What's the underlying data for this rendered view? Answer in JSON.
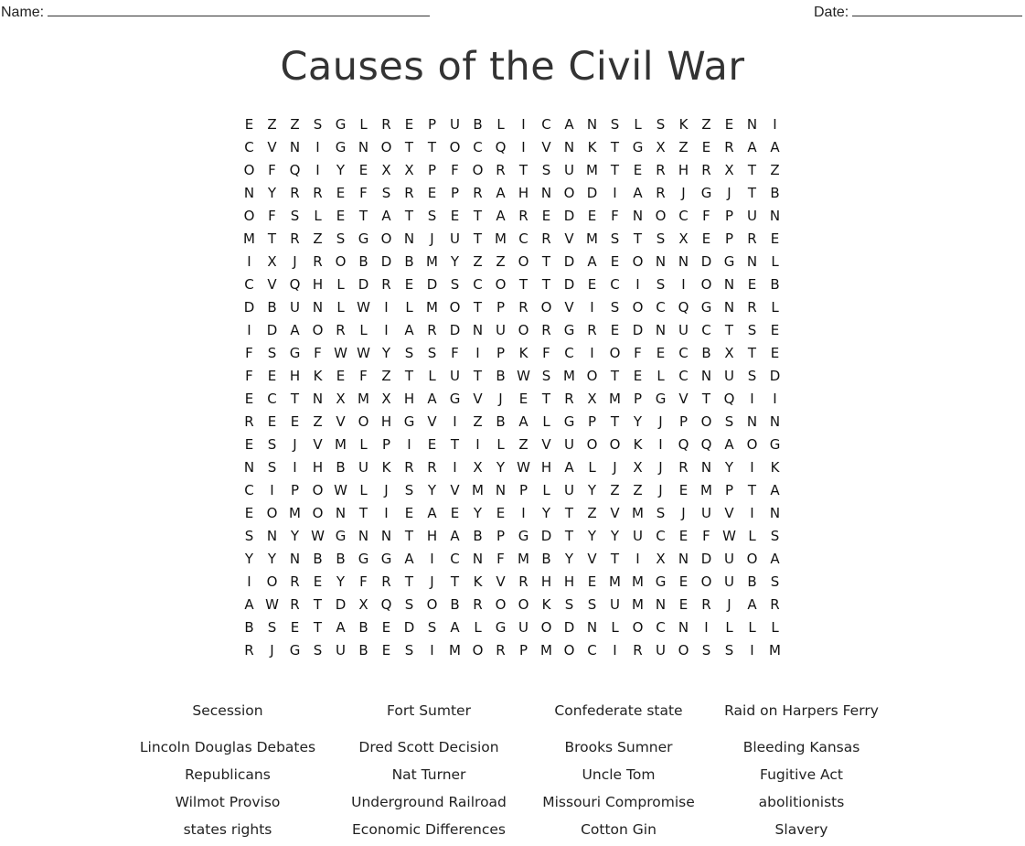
{
  "header": {
    "name_label": "Name:",
    "date_label": "Date:"
  },
  "title": "Causes of the Civil War",
  "grid": [
    "EZZSGLREPUBLICANSLSKZENI",
    "CVNIGNOTTOCQIVNKTGXZERAA",
    "OFQIYEXXPFORTSUMTERHRXTZ",
    "NYRREFSREPRAHNODIARJGJTB",
    "OFSLETATSETAREDEFNOCFPUN",
    "MTRZSGONJUTMCRVMSTSXEPRE",
    "IXJROBDBMYZZOTDAEONNDGNL",
    "CVQHLDREDSCOTTDECISIONEB",
    "DBUNLWILMOTPROVISOCQGNRL",
    "IDAORLIARDNUORGREDNUCTSE",
    "FSGFWWYSSFIPKFCIOFECBXTE",
    "FEHKEFZTLUTBWSMOTELCNUSD",
    "ECTNXMXHAGVJETRXMPGVTQII",
    "REEZVOHGVIZBALGPTYJPOSNN",
    "ESJVMLPIETILZVUOOKIQQAOG",
    "NSIHBUKRRIXYWHALJXJRNYIK",
    "CIPOWLJSYVMNPLUYZZJEMPTA",
    "EOMONTIEAEYEIYTZVMSJUVIN",
    "SNYWGNNTHABPGDTYYUCEFWLS",
    "YYNBBGGAICNFMBYVTIXNDUOA",
    "IOREYFRTJTKVRHHEMMGEOUBS",
    "AWRTDXQSOBROOKSSUMNERJAR",
    "BSETABEDSALGUODNLOCNILLL",
    "RJGSUBESIMORPMOCIRUOSSIM"
  ],
  "words": [
    "Secession",
    "Fort Sumter",
    "Confederate state",
    "Raid on Harpers Ferry",
    "Lincoln Douglas Debates",
    "Dred Scott Decision",
    "Brooks Sumner",
    "Bleeding Kansas",
    "Republicans",
    "Nat Turner",
    "Uncle Tom",
    "Fugitive Act",
    "Wilmot Proviso",
    "Underground Railroad",
    "Missouri Compromise",
    "abolitionists",
    "states rights",
    "Economic Differences",
    "Cotton Gin",
    "Slavery"
  ]
}
